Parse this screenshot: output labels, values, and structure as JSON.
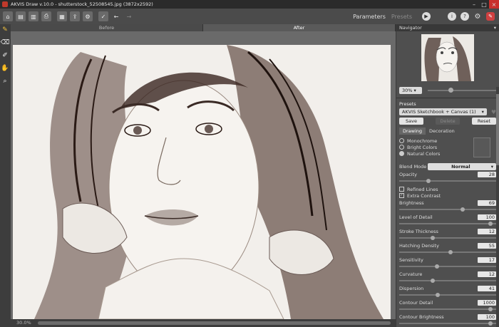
{
  "window": {
    "title": "AKVIS Draw v.10.0 - shutterstock_52508545.jpg (3872x2592)"
  },
  "toolbar": {
    "tabs": [
      {
        "label": "Parameters",
        "active": true
      },
      {
        "label": "Presets",
        "active": false
      }
    ],
    "icons": [
      "file-open-icon",
      "file-save-icon",
      "print-icon",
      "batch-icon",
      "share-icon",
      "settings-icon",
      "check-icon",
      "back-icon",
      "forward-icon"
    ],
    "right_icons": [
      "play-icon",
      "info-icon",
      "help-icon",
      "gear-icon",
      "app-logo-icon"
    ]
  },
  "canvas": {
    "tabs": [
      {
        "label": "Before",
        "active": false
      },
      {
        "label": "After",
        "active": true
      }
    ],
    "zoom": "30.0%"
  },
  "navigator": {
    "title": "Navigator",
    "zoom": "30%",
    "zoom_fraction": 0.3
  },
  "presets": {
    "label": "Presets",
    "selected": "AKVIS Sketchbook + Canvas (1)",
    "buttons": {
      "save": "Save",
      "delete": "Delete",
      "reset": "Reset"
    }
  },
  "tabs": [
    {
      "label": "Drawing",
      "active": true
    },
    {
      "label": "Decoration",
      "active": false
    }
  ],
  "color_mode": {
    "options": [
      {
        "label": "Monochrome",
        "selected": false
      },
      {
        "label": "Bright Colors",
        "selected": false
      },
      {
        "label": "Natural Colors",
        "selected": true
      }
    ]
  },
  "blend_mode": {
    "label": "Blend Mode",
    "value": "Normal"
  },
  "opacity": {
    "label": "Opacity",
    "value": "28",
    "fraction": 0.28
  },
  "checks": [
    {
      "label": "Refined Lines",
      "checked": false
    },
    {
      "label": "Extra Contrast",
      "checked": true
    }
  ],
  "params": [
    {
      "label": "Brightness",
      "value": "69",
      "fraction": 0.69
    },
    {
      "label": "Level of Detail",
      "value": "100",
      "fraction": 1.0
    },
    {
      "label": "Stroke Thickness",
      "value": "12",
      "fraction": 0.35
    },
    {
      "label": "Hatching Density",
      "value": "55",
      "fraction": 0.55
    },
    {
      "label": "Sensitivity",
      "value": "17",
      "fraction": 0.4
    },
    {
      "label": "Curvature",
      "value": "12",
      "fraction": 0.35
    },
    {
      "label": "Dispersion",
      "value": "41",
      "fraction": 0.41
    },
    {
      "label": "Contour Detail",
      "value": "1000",
      "fraction": 1.0
    },
    {
      "label": "Contour Brightness",
      "value": "100",
      "fraction": 1.0
    }
  ],
  "tools": [
    "brush-icon",
    "eraser-icon",
    "history-brush-icon",
    "hand-icon",
    "zoom-icon"
  ]
}
